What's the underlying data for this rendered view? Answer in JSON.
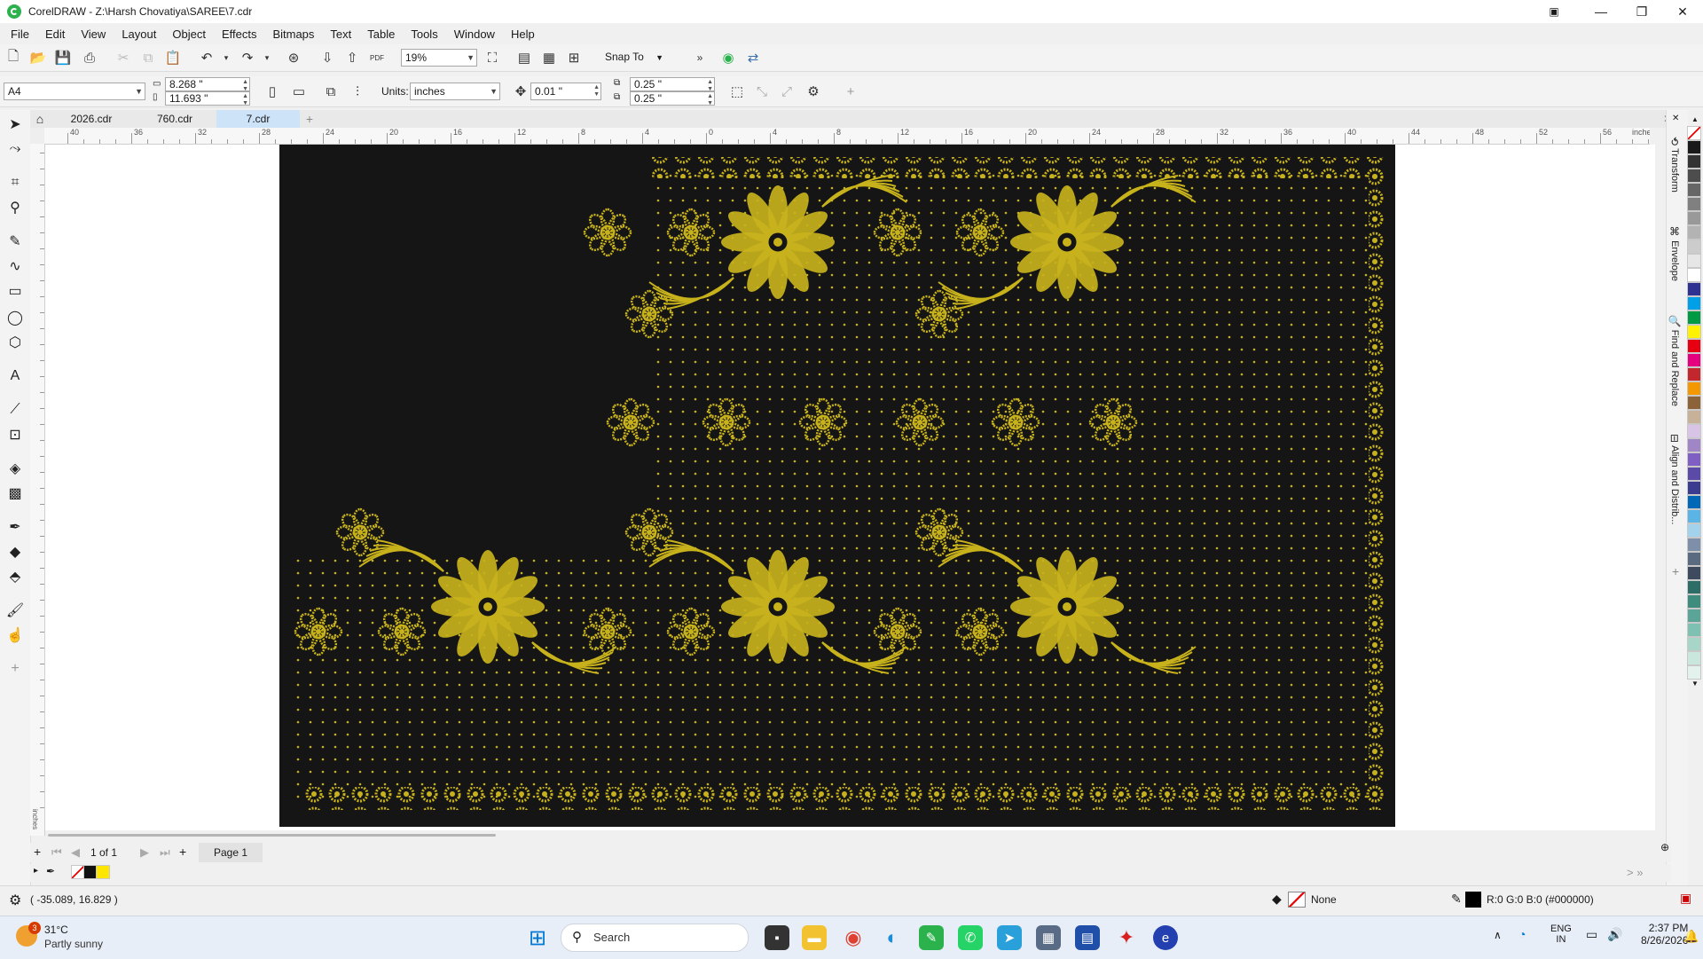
{
  "window": {
    "title": "CorelDRAW - Z:\\Harsh Chovatiya\\SAREE\\7.cdr",
    "min": "—",
    "restore": "❐",
    "close": "✕"
  },
  "menu": [
    "File",
    "Edit",
    "View",
    "Layout",
    "Object",
    "Effects",
    "Bitmaps",
    "Text",
    "Table",
    "Tools",
    "Window",
    "Help"
  ],
  "standard_toolbar": {
    "zoom": "19%",
    "snap_to": "Snap To",
    "pdf_label": "PDF"
  },
  "property_bar": {
    "page_size": "A4",
    "width": "8.268 \"",
    "height": "11.693 \"",
    "units_label": "Units:",
    "units": "inches",
    "nudge": "0.01 \"",
    "dup_x": "0.25 \"",
    "dup_y": "0.25 \""
  },
  "tabs": [
    {
      "label": "2026.cdr",
      "active": false
    },
    {
      "label": "760.cdr",
      "active": false
    },
    {
      "label": "7.cdr",
      "active": true
    }
  ],
  "ruler": {
    "h_labels": [
      "40",
      "36",
      "32",
      "28",
      "24",
      "20",
      "16",
      "12",
      "8",
      "4",
      "0",
      "4",
      "8",
      "12",
      "16",
      "20",
      "24",
      "28",
      "32",
      "36",
      "40",
      "44",
      "48",
      "52",
      "56"
    ],
    "unit": "inches"
  },
  "dockers": [
    "Transform",
    "Envelope",
    "Find and Replace",
    "Align and Distrib..."
  ],
  "palette": [
    "#ffffff",
    "#1a1a1a",
    "#333333",
    "#4d4d4d",
    "#666666",
    "#808080",
    "#999999",
    "#b3b3b3",
    "#cccccc",
    "#e6e6e6",
    "#ffffff",
    "#2e3192",
    "#00a0e9",
    "#009944",
    "#fff100",
    "#e60012",
    "#e4007f",
    "#c1272d",
    "#f39800",
    "#8c6239",
    "#c7b299",
    "#d7c4e7",
    "#a086c7",
    "#7f5fc3",
    "#5b4aa8",
    "#3b3b8f",
    "#0068b7",
    "#5ab4e5",
    "#a3d3ec",
    "#7d8fa9",
    "#596a81",
    "#3e4a5e",
    "#2d6d68",
    "#3e8c7e",
    "#5aa597",
    "#7cc1b1",
    "#a7d6c8",
    "#c9e7dc",
    "#e3f2ec"
  ],
  "page_nav": {
    "counter": "1 of 1",
    "page_tab": "Page 1"
  },
  "status": {
    "coords": "( -35.089, 16.829 )",
    "fill": "None",
    "outline": "R:0 G:0 B:0 (#000000)"
  },
  "taskbar": {
    "weather_temp": "31°C",
    "weather_desc": "Partly sunny",
    "weather_badge": "3",
    "search": "Search",
    "lang": "ENG",
    "region": "IN",
    "time": "2:37 PM",
    "date": "8/26/2026"
  },
  "colors": {
    "accent": "#0078d4",
    "gold": "#c8b21c",
    "page_bg": "#151515"
  }
}
